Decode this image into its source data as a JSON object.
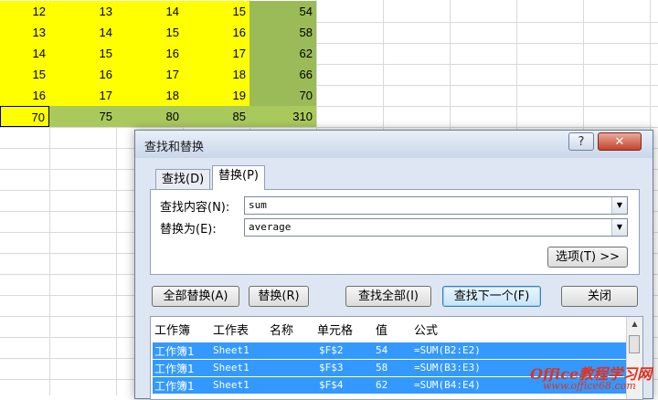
{
  "sheet": {
    "rows": [
      [
        "12",
        "13",
        "14",
        "15",
        "54"
      ],
      [
        "13",
        "14",
        "15",
        "16",
        "58"
      ],
      [
        "14",
        "15",
        "16",
        "17",
        "62"
      ],
      [
        "15",
        "16",
        "17",
        "18",
        "66"
      ],
      [
        "16",
        "17",
        "18",
        "19",
        "70"
      ],
      [
        "70",
        "75",
        "80",
        "85",
        "310"
      ]
    ]
  },
  "dialog": {
    "title": "查找和替换",
    "help": "?",
    "close": "✕",
    "tabs": [
      "查找(D)",
      "替换(P)"
    ],
    "find_label": "查找内容(N):",
    "find_value": "sum",
    "replace_label": "替换为(E):",
    "replace_value": "average",
    "options_button": "选项(T) >>",
    "buttons": {
      "replace_all": "全部替换(A)",
      "replace": "替换(R)",
      "find_all": "查找全部(I)",
      "find_next": "查找下一个(F)",
      "close": "关闭"
    },
    "results": {
      "headers": [
        "工作簿",
        "工作表",
        "名称",
        "单元格",
        "值",
        "公式"
      ],
      "rows": [
        [
          "工作簿1",
          "Sheet1",
          "",
          "$F$2",
          "54",
          "=SUM(B2:E2)"
        ],
        [
          "工作簿1",
          "Sheet1",
          "",
          "$F$3",
          "58",
          "=SUM(B3:E3)"
        ],
        [
          "工作簿1",
          "Sheet1",
          "",
          "$F$4",
          "62",
          "=SUM(B4:E4)"
        ]
      ]
    }
  },
  "watermark": {
    "line1": "Office教程学习网",
    "line2": "www.office68.com"
  },
  "colors": {
    "yellow": "#ffff00",
    "green": "#9bbb59",
    "selection": "#3399ff"
  }
}
